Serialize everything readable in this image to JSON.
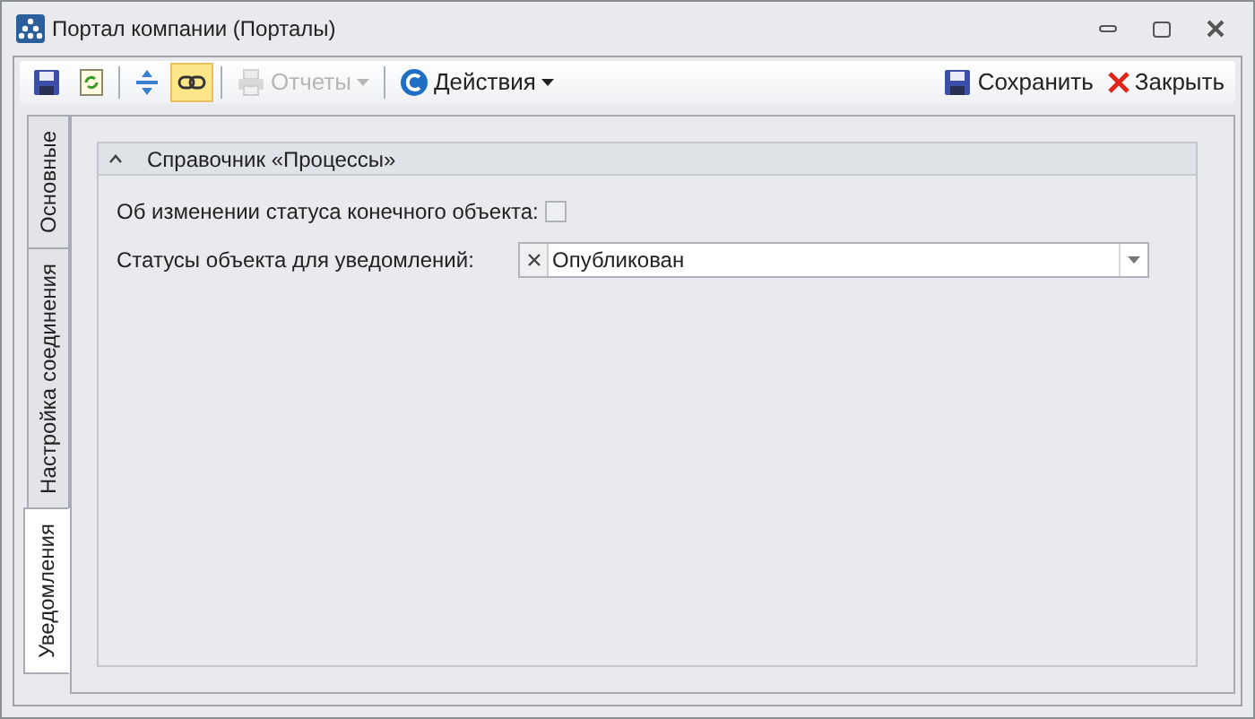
{
  "window": {
    "title": "Портал компании (Порталы)"
  },
  "toolbar": {
    "left": [
      {
        "kind": "save",
        "selected": false,
        "disabled": false
      },
      {
        "kind": "refresh",
        "selected": false,
        "disabled": false
      },
      {
        "kind": "separator"
      },
      {
        "kind": "expand",
        "selected": false,
        "disabled": false
      },
      {
        "kind": "link",
        "selected": true,
        "disabled": false
      },
      {
        "kind": "separator"
      },
      {
        "kind": "print",
        "label": "Отчеты",
        "dropdown": true,
        "selected": false,
        "disabled": true
      },
      {
        "kind": "separator"
      },
      {
        "kind": "actions",
        "label": "Действия",
        "dropdown": true,
        "selected": false,
        "disabled": false
      }
    ],
    "right": [
      {
        "kind": "save",
        "label": "Сохранить"
      },
      {
        "kind": "close",
        "label": "Закрыть"
      }
    ]
  },
  "tabs": [
    {
      "label": "Основные",
      "selected": false
    },
    {
      "label": "Настройка соединения",
      "selected": false
    },
    {
      "label": "Уведомления",
      "selected": true
    }
  ],
  "group": {
    "title": "Справочник «Процессы»",
    "expanded": true
  },
  "fields": [
    {
      "kind": "checkbox",
      "label": "Об изменении статуса конечного объекта:",
      "checked": false
    },
    {
      "kind": "combo",
      "label": "Статусы объекта для уведомлений:",
      "value": "Опубликован"
    }
  ]
}
